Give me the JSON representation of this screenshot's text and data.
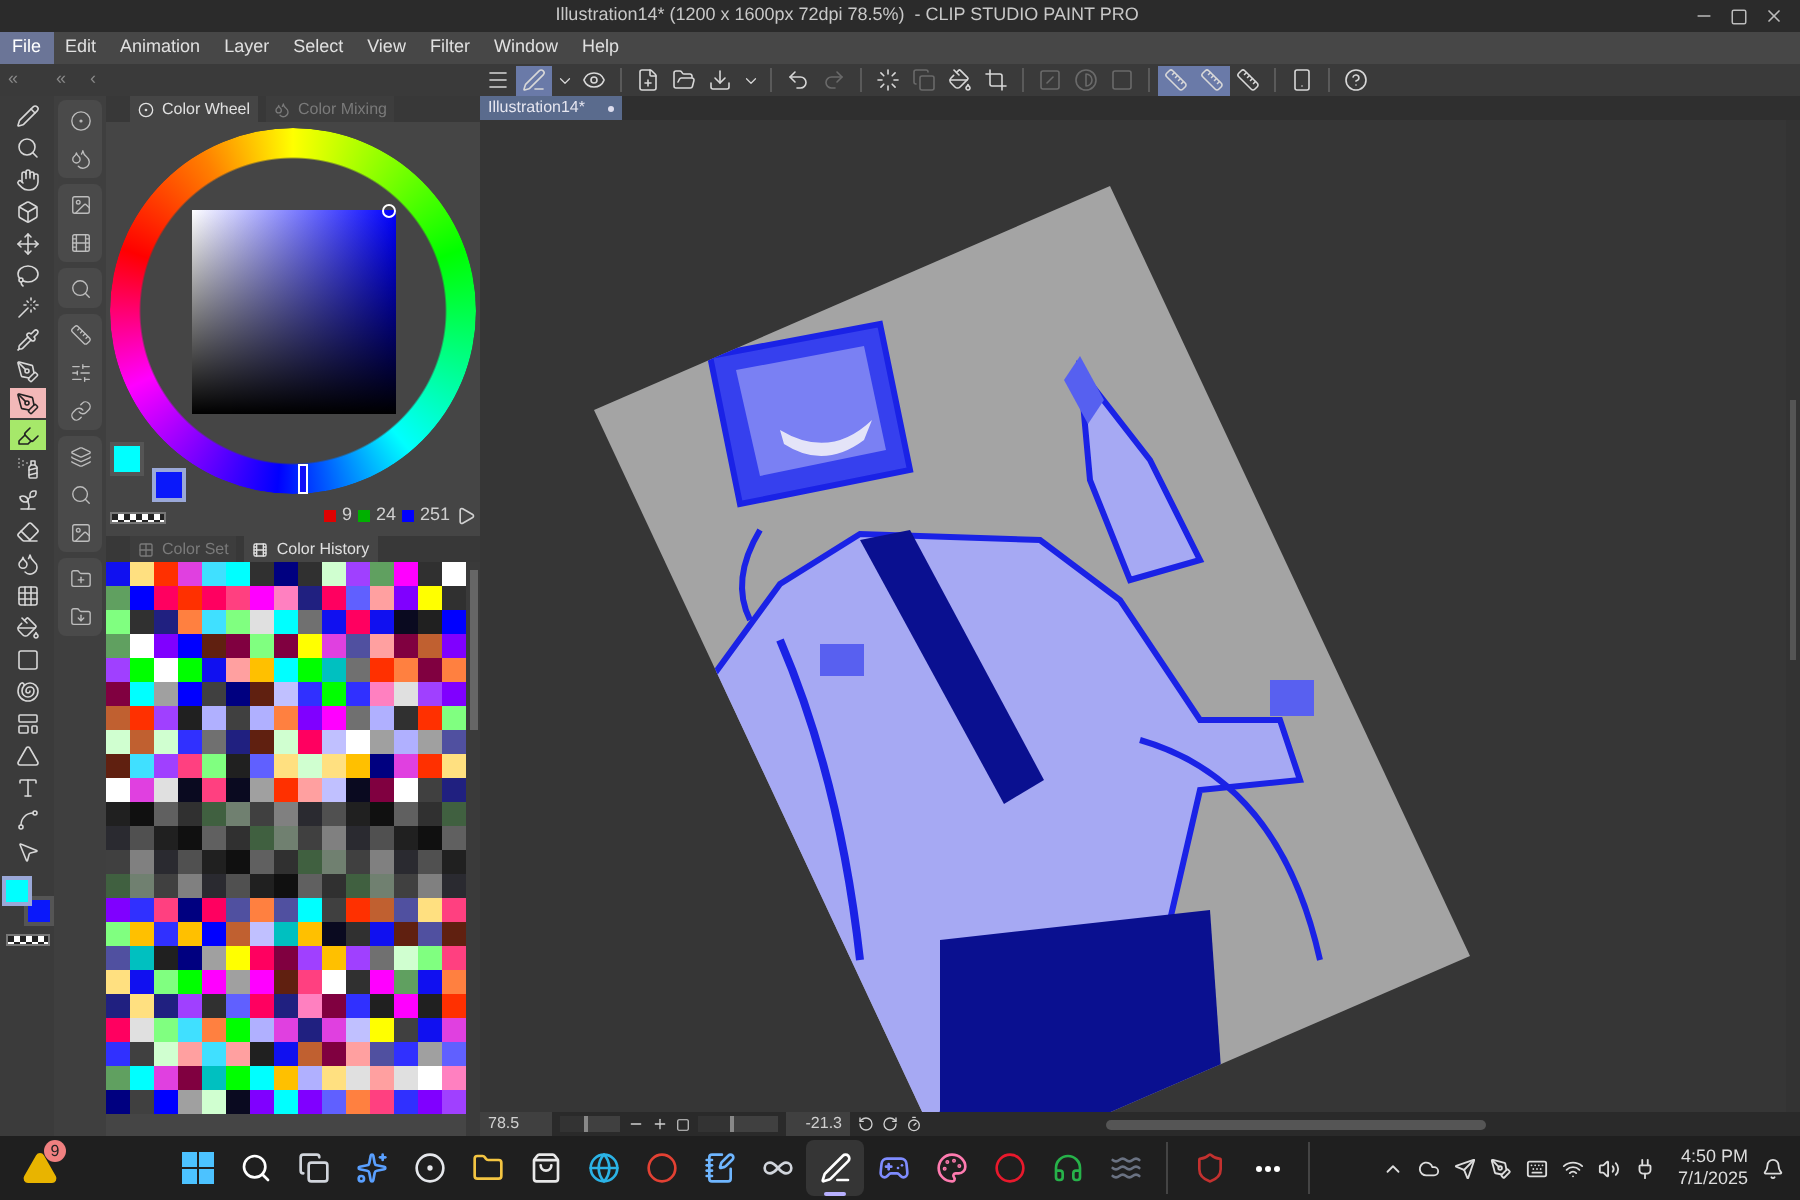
{
  "window": {
    "title": "Illustration14* (1200 x 1600px 72dpi 78.5%)  - CLIP STUDIO PAINT PRO"
  },
  "menu": [
    {
      "label": "File",
      "selected": true
    },
    {
      "label": "Edit",
      "selected": false
    },
    {
      "label": "Animation",
      "selected": false
    },
    {
      "label": "Layer",
      "selected": false
    },
    {
      "label": "Select",
      "selected": false
    },
    {
      "label": "View",
      "selected": false
    },
    {
      "label": "Filter",
      "selected": false
    },
    {
      "label": "Window",
      "selected": false
    },
    {
      "label": "Help",
      "selected": false
    }
  ],
  "collapse_arrows": [
    "«",
    "«",
    "‹"
  ],
  "command_bar": [
    {
      "kind": "menu",
      "selected": false,
      "disabled": false
    },
    {
      "kind": "pen",
      "selected": true,
      "disabled": false
    },
    {
      "kind": "chevron",
      "selected": false,
      "disabled": false
    },
    {
      "kind": "eye",
      "selected": false,
      "disabled": false
    },
    {
      "kind": "sep"
    },
    {
      "kind": "new",
      "selected": false,
      "disabled": false
    },
    {
      "kind": "open",
      "selected": false,
      "disabled": false
    },
    {
      "kind": "save",
      "selected": false,
      "disabled": false
    },
    {
      "kind": "chevron",
      "selected": false,
      "disabled": false
    },
    {
      "kind": "sep"
    },
    {
      "kind": "undo",
      "selected": false,
      "disabled": false
    },
    {
      "kind": "redo",
      "selected": false,
      "disabled": true
    },
    {
      "kind": "sep"
    },
    {
      "kind": "loader",
      "selected": false,
      "disabled": false
    },
    {
      "kind": "copy",
      "selected": false,
      "disabled": true
    },
    {
      "kind": "fill",
      "selected": false,
      "disabled": false
    },
    {
      "kind": "crop",
      "selected": false,
      "disabled": false
    },
    {
      "kind": "sep"
    },
    {
      "kind": "slash",
      "selected": false,
      "disabled": true
    },
    {
      "kind": "contrast",
      "selected": false,
      "disabled": true
    },
    {
      "kind": "square",
      "selected": false,
      "disabled": true
    },
    {
      "kind": "sep"
    },
    {
      "kind": "ruler",
      "selected": true,
      "disabled": false
    },
    {
      "kind": "ruler",
      "selected": true,
      "disabled": false
    },
    {
      "kind": "ruler",
      "selected": false,
      "disabled": false
    },
    {
      "kind": "sep"
    },
    {
      "kind": "phone",
      "selected": false,
      "disabled": false
    },
    {
      "kind": "sep"
    },
    {
      "kind": "help",
      "selected": false,
      "disabled": false
    }
  ],
  "tools": [
    {
      "kind": "pencil",
      "selected": false
    },
    {
      "kind": "zoom",
      "selected": false
    },
    {
      "kind": "hand",
      "selected": false
    },
    {
      "kind": "rotate",
      "selected": false
    },
    {
      "kind": "move",
      "selected": false
    },
    {
      "kind": "lasso",
      "selected": false
    },
    {
      "kind": "wand",
      "selected": false
    },
    {
      "kind": "eyedropper",
      "selected": false
    },
    {
      "kind": "pen",
      "selected": false
    },
    {
      "kind": "pen",
      "selected": true,
      "color": "#f2b8b8"
    },
    {
      "kind": "marker",
      "selected": true,
      "color": "#a6e86a"
    },
    {
      "kind": "airbrush",
      "selected": false
    },
    {
      "kind": "decoration",
      "selected": false
    },
    {
      "kind": "eraser",
      "selected": false
    },
    {
      "kind": "blend",
      "selected": false
    },
    {
      "kind": "grid",
      "selected": false
    },
    {
      "kind": "fill",
      "selected": false
    },
    {
      "kind": "gradient",
      "selected": false
    },
    {
      "kind": "spiral",
      "selected": false
    },
    {
      "kind": "frame",
      "selected": false
    },
    {
      "kind": "figure",
      "selected": false
    },
    {
      "kind": "text",
      "selected": false
    },
    {
      "kind": "correction",
      "selected": false
    },
    {
      "kind": "operation",
      "selected": false
    }
  ],
  "tool_colors": [
    {
      "kind": "main",
      "color": "#00ffff",
      "selected": true
    },
    {
      "kind": "sub",
      "color": "#0a18fa",
      "selected": false
    }
  ],
  "color_wheel": {
    "tabs": [
      {
        "label": "Color Wheel",
        "selected": true
      },
      {
        "label": "Color Mixing",
        "selected": false
      }
    ],
    "swatches": [
      {
        "kind": "main",
        "color": "#00ffff",
        "selected": false
      },
      {
        "kind": "sub",
        "color": "#0a18fa",
        "selected": true
      }
    ],
    "readings": [
      {
        "color": "#e00000",
        "value": "9"
      },
      {
        "color": "#00b000",
        "value": "24"
      },
      {
        "color": "#0000ff",
        "value": "251"
      }
    ]
  },
  "color_history": {
    "tabs": [
      {
        "label": "Color Set",
        "selected": false
      },
      {
        "label": "Color History",
        "selected": true
      }
    ]
  },
  "document_tab": {
    "label": "Illustration14*"
  },
  "status_bar": {
    "zoom": "78.5",
    "zoom_slider": {
      "level": 0.45
    },
    "rotation": "-21.3",
    "rotation_slider": {
      "level": 0.44
    }
  },
  "taskbar": {
    "widget_badge": "9",
    "apps": [
      {
        "kind": "start",
        "selected": false
      },
      {
        "kind": "search",
        "selected": false
      },
      {
        "kind": "taskview",
        "selected": false
      },
      {
        "kind": "copilot",
        "selected": false
      },
      {
        "kind": "obs",
        "selected": false
      },
      {
        "kind": "explorer",
        "selected": false
      },
      {
        "kind": "store",
        "selected": false
      },
      {
        "kind": "edge",
        "selected": false
      },
      {
        "kind": "chrome",
        "selected": false
      },
      {
        "kind": "notepad",
        "selected": false
      },
      {
        "kind": "cloud",
        "selected": false
      },
      {
        "kind": "paint",
        "selected": true
      },
      {
        "kind": "chat",
        "selected": false
      },
      {
        "kind": "palette",
        "selected": false
      },
      {
        "kind": "opera",
        "selected": false
      },
      {
        "kind": "headphones",
        "selected": false
      },
      {
        "kind": "waves",
        "selected": false
      },
      {
        "kind": "sep"
      },
      {
        "kind": "shield",
        "selected": false
      },
      {
        "kind": "more",
        "selected": false
      },
      {
        "kind": "sep"
      }
    ],
    "time": "4:50 PM",
    "date": "7/1/2025"
  }
}
